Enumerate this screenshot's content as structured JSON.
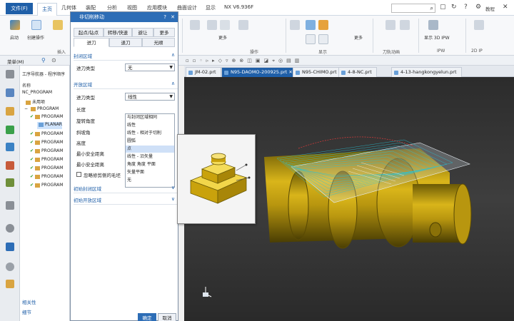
{
  "menu": {
    "file": "文件(F)",
    "items": [
      "主页",
      "几何体",
      "装配",
      "分析",
      "视图",
      "应用模块",
      "曲面设计",
      "显示"
    ],
    "title": "NX V6.936F",
    "search_placeholder": "",
    "help_label": "教程"
  },
  "ribbon": {
    "groups": [
      "插入",
      "操作",
      "显示",
      "刀轨动画",
      "IPW",
      "2D IP"
    ],
    "labels": [
      "启动",
      "创建操作",
      "更多",
      "更多",
      "显示 3D IPW"
    ]
  },
  "toolbar2": {
    "menu_label": "菜单(M)"
  },
  "file_tabs": [
    "JM-02.prt",
    "N95-DAOMO-200925.prt",
    "N95-CHIMO.prt",
    "4-8-NC.prt",
    "4-13-hangkongyelun.prt"
  ],
  "nav": {
    "title": "工序导航器 - 程序顺序",
    "col_name": "名称",
    "tree": [
      {
        "label": "NC_PROGRAM",
        "type": "root"
      },
      {
        "label": "未用项",
        "type": "folder"
      },
      {
        "label": "PROGRAM",
        "type": "folder"
      },
      {
        "label": "PROGRAM",
        "type": "op"
      },
      {
        "label": "PLANAR",
        "type": "op-selected"
      },
      {
        "label": "PROGRAM",
        "type": "op"
      },
      {
        "label": "PROGRAM",
        "type": "op"
      },
      {
        "label": "PROGRAM",
        "type": "op"
      },
      {
        "label": "PROGRAM",
        "type": "op"
      },
      {
        "label": "PROGRAM",
        "type": "op"
      },
      {
        "label": "PROGRAM",
        "type": "op"
      },
      {
        "label": "PROGRAM",
        "type": "op"
      }
    ],
    "bottom": [
      "相关性",
      "细节"
    ]
  },
  "dialog": {
    "title": "非切削移动",
    "help": "?",
    "close": "✕",
    "tabs_row1": [
      "起点/钻点",
      "转移/快速",
      "避让",
      "更多"
    ],
    "tabs_row2": [
      "进刀",
      "退刀",
      "光顺"
    ],
    "sec_closed": "封闭区域",
    "closed_type_label": "进刀类型",
    "closed_type_value": "无",
    "sec_open": "开放区域",
    "open_type_label": "进刀类型",
    "open_type_value": "线性",
    "rows": [
      "长度",
      "旋转角度",
      "斜坡角",
      "高度",
      "最小安全距离",
      "最小安全距离"
    ],
    "options": [
      "与封闭区域相同",
      "线性",
      "线性 - 相对于切削",
      "圆弧",
      "点",
      "线性 - 沿矢量",
      "角度 角度 平面",
      "矢量平面",
      "无"
    ],
    "highlighted_option": 4,
    "checkbox_label": "忽略修剪侧的毛坯",
    "sec_init_closed": "初始封闭区域",
    "sec_init_open": "初始开放区域",
    "ok": "确定",
    "cancel": "取消"
  },
  "colors": {
    "accent": "#1f5fa8",
    "part": "#c9a20c",
    "toolpath": "#27c3d6"
  }
}
